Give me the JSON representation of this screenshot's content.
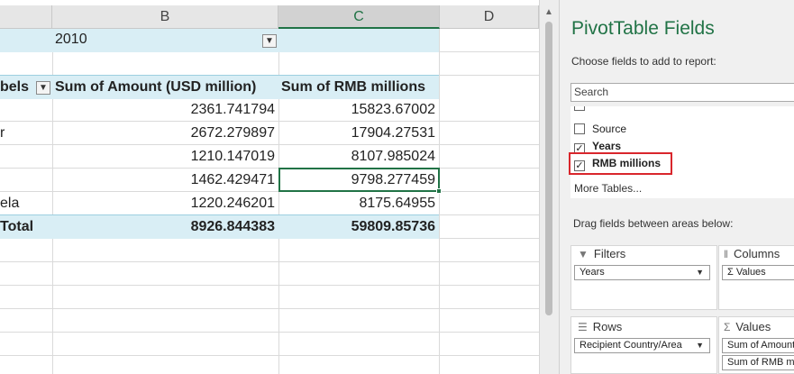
{
  "sheet": {
    "columns": [
      "B",
      "C",
      "D"
    ],
    "filter_value": "2010",
    "header": {
      "row_labels": "bels",
      "col_b": "Sum of Amount (USD million)",
      "col_c": "Sum of RMB millions"
    },
    "rows": [
      {
        "label": "",
        "b": "2361.741794",
        "c": "15823.67002"
      },
      {
        "label": "r",
        "b": "2672.279897",
        "c": "17904.27531"
      },
      {
        "label": "",
        "b": "1210.147019",
        "c": "8107.985024"
      },
      {
        "label": "",
        "b": "1462.429471",
        "c": "9798.277459"
      },
      {
        "label": "ela",
        "b": "1220.246201",
        "c": "8175.64955"
      }
    ],
    "total": {
      "label": "Total",
      "b": "8926.844383",
      "c": "59809.85736"
    }
  },
  "pane": {
    "title": "PivotTable Fields",
    "subtitle": "Choose fields to add to report:",
    "search_placeholder": "Search",
    "fields": [
      {
        "label": "Source",
        "checked": false
      },
      {
        "label": "Years",
        "checked": true
      },
      {
        "label": "RMB millions",
        "checked": true
      }
    ],
    "more_tables": "More Tables...",
    "drag_text": "Drag fields between areas below:",
    "areas": {
      "filters": {
        "label": "Filters",
        "items": [
          "Years"
        ]
      },
      "columns": {
        "label": "Columns",
        "items": [
          "Values"
        ]
      },
      "rows": {
        "label": "Rows",
        "items": [
          "Recipient Country/Area"
        ]
      },
      "values": {
        "label": "Values",
        "items": [
          "Sum of Amount",
          "Sum of RMB mi"
        ]
      }
    },
    "accent_color": "#217346",
    "highlight_color": "#d9262c"
  }
}
